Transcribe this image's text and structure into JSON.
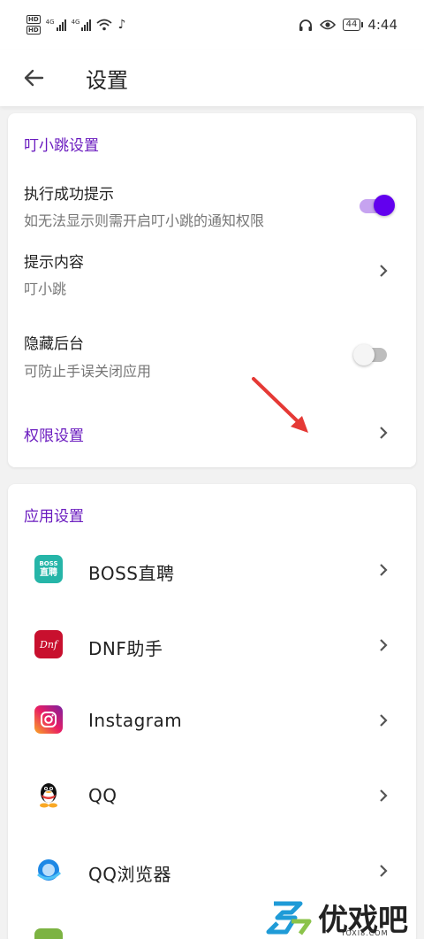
{
  "status_bar": {
    "hd1": "HD",
    "hd2": "HD",
    "net1": "4G",
    "net2": "4G",
    "battery": "44",
    "time": "4:44"
  },
  "app_bar": {
    "title": "设置"
  },
  "ding_section": {
    "title": "叮小跳设置",
    "success_tip": {
      "title": "执行成功提示",
      "subtitle": "如无法显示则需开启叮小跳的通知权限",
      "enabled": true
    },
    "tip_content": {
      "title": "提示内容",
      "value": "叮小跳"
    },
    "hide_background": {
      "title": "隐藏后台",
      "subtitle": "可防止手误关闭应用",
      "enabled": false
    },
    "permission": {
      "title": "权限设置"
    }
  },
  "app_section": {
    "title": "应用设置",
    "apps": [
      {
        "name": "BOSS直聘",
        "icon": "boss-zhipin-icon",
        "icon_text_top": "BOSS",
        "icon_text_bottom": "直聘"
      },
      {
        "name": "DNF助手",
        "icon": "dnf-helper-icon",
        "icon_text": "Dnf"
      },
      {
        "name": "Instagram",
        "icon": "instagram-icon"
      },
      {
        "name": "QQ",
        "icon": "qq-penguin-icon"
      },
      {
        "name": "QQ浏览器",
        "icon": "qq-browser-icon"
      }
    ]
  },
  "watermark": {
    "brand": "优戏吧",
    "url": "YOXI8.COM"
  },
  "colors": {
    "accent": "#6a1bbf",
    "toggle_on": "#6200ee",
    "arrow": "#e53935"
  }
}
